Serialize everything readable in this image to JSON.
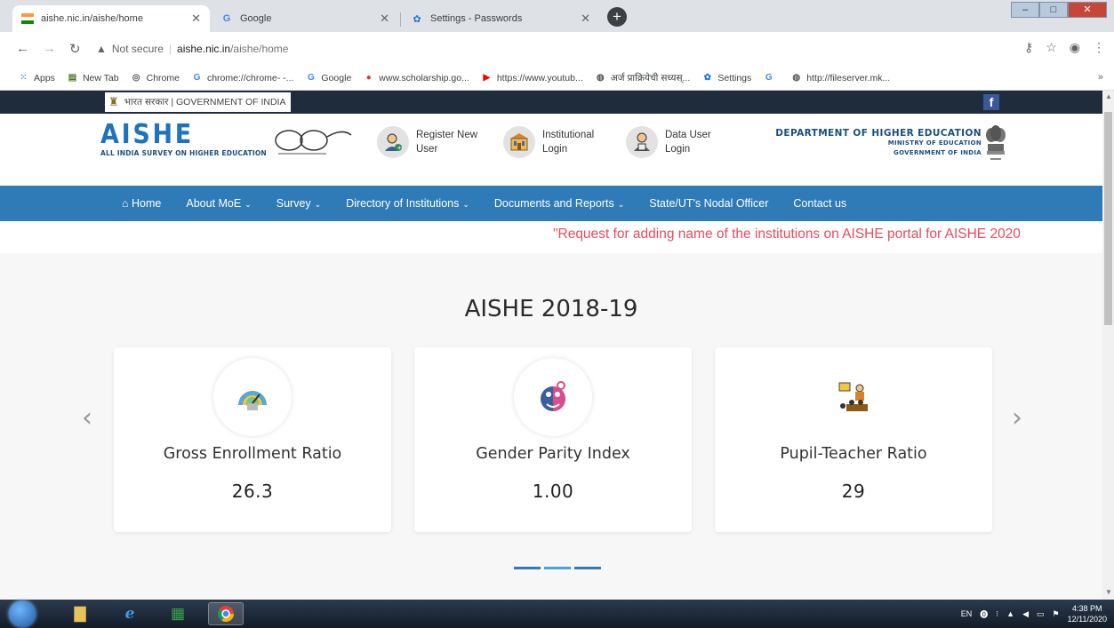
{
  "browser": {
    "tabs": [
      {
        "title": "aishe.nic.in/aishe/home",
        "active": true
      },
      {
        "title": "Google",
        "active": false
      },
      {
        "title": "Settings - Passwords",
        "active": false
      }
    ],
    "new_tab_label": "+",
    "address": {
      "security": "Not secure",
      "host": "aishe.nic.in",
      "path": "/aishe/home"
    },
    "bookmarks": [
      {
        "label": "Apps",
        "icon": "apps-grid-icon"
      },
      {
        "label": "New Tab",
        "icon": "new-tab-icon"
      },
      {
        "label": "Chrome",
        "icon": "chrome-icon"
      },
      {
        "label": "chrome://chrome- -...",
        "icon": "google-icon"
      },
      {
        "label": "Google",
        "icon": "google-icon"
      },
      {
        "label": "www.scholarship.go...",
        "icon": "scholarship-icon"
      },
      {
        "label": "https://www.youtub...",
        "icon": "youtube-icon"
      },
      {
        "label": "अर्ज प्राक्रियेची सध्यस्...",
        "icon": "globe-icon"
      },
      {
        "label": "Settings",
        "icon": "settings-icon"
      },
      {
        "label": "",
        "icon": "google-icon"
      },
      {
        "label": "http://fileserver.mk...",
        "icon": "globe-icon"
      }
    ],
    "bookmarks_more": "»"
  },
  "site": {
    "gov_label": "भारत सरकार | GOVERNMENT OF INDIA",
    "logo_big": "AISHE",
    "logo_small": "ALL INDIA SURVEY ON HIGHER EDUCATION",
    "links": [
      {
        "line1": "Register New",
        "line2": "User",
        "icon": "register-user-icon"
      },
      {
        "line1": "Institutional",
        "line2": "Login",
        "icon": "institution-icon"
      },
      {
        "line1": "Data User",
        "line2": "Login",
        "icon": "data-user-icon"
      }
    ],
    "dept_line1": "DEPARTMENT OF HIGHER EDUCATION",
    "dept_line2": "MINISTRY OF EDUCATION",
    "dept_line3": "GOVERNMENT OF INDIA",
    "nav": [
      {
        "label": "Home",
        "dropdown": false
      },
      {
        "label": "About MoE",
        "dropdown": true
      },
      {
        "label": "Survey",
        "dropdown": true
      },
      {
        "label": "Directory of Institutions",
        "dropdown": true
      },
      {
        "label": "Documents and Reports",
        "dropdown": true
      },
      {
        "label": "State/UT's Nodal Officer",
        "dropdown": false
      },
      {
        "label": "Contact us",
        "dropdown": false
      }
    ],
    "marquee": "\"Request for adding name of the institutions on AISHE portal for AISHE 2020",
    "section_title": "AISHE 2018-19",
    "cards": [
      {
        "label": "Gross Enrollment Ratio",
        "value": "26.3",
        "icon": "gauge-icon"
      },
      {
        "label": "Gender Parity Index",
        "value": "1.00",
        "icon": "gender-icon"
      },
      {
        "label": "Pupil-Teacher Ratio",
        "value": "29",
        "icon": "classroom-icon"
      }
    ],
    "prev_arrow": "‹",
    "next_arrow": "›"
  },
  "taskbar": {
    "lang": "EN",
    "time": "4:38 PM",
    "date": "12/11/2020"
  },
  "colors": {
    "nav_blue": "#2f7bb8",
    "gov_bar": "#1e2c3c",
    "marquee_red": "#e64b5d",
    "logo_blue": "#1e73be"
  }
}
